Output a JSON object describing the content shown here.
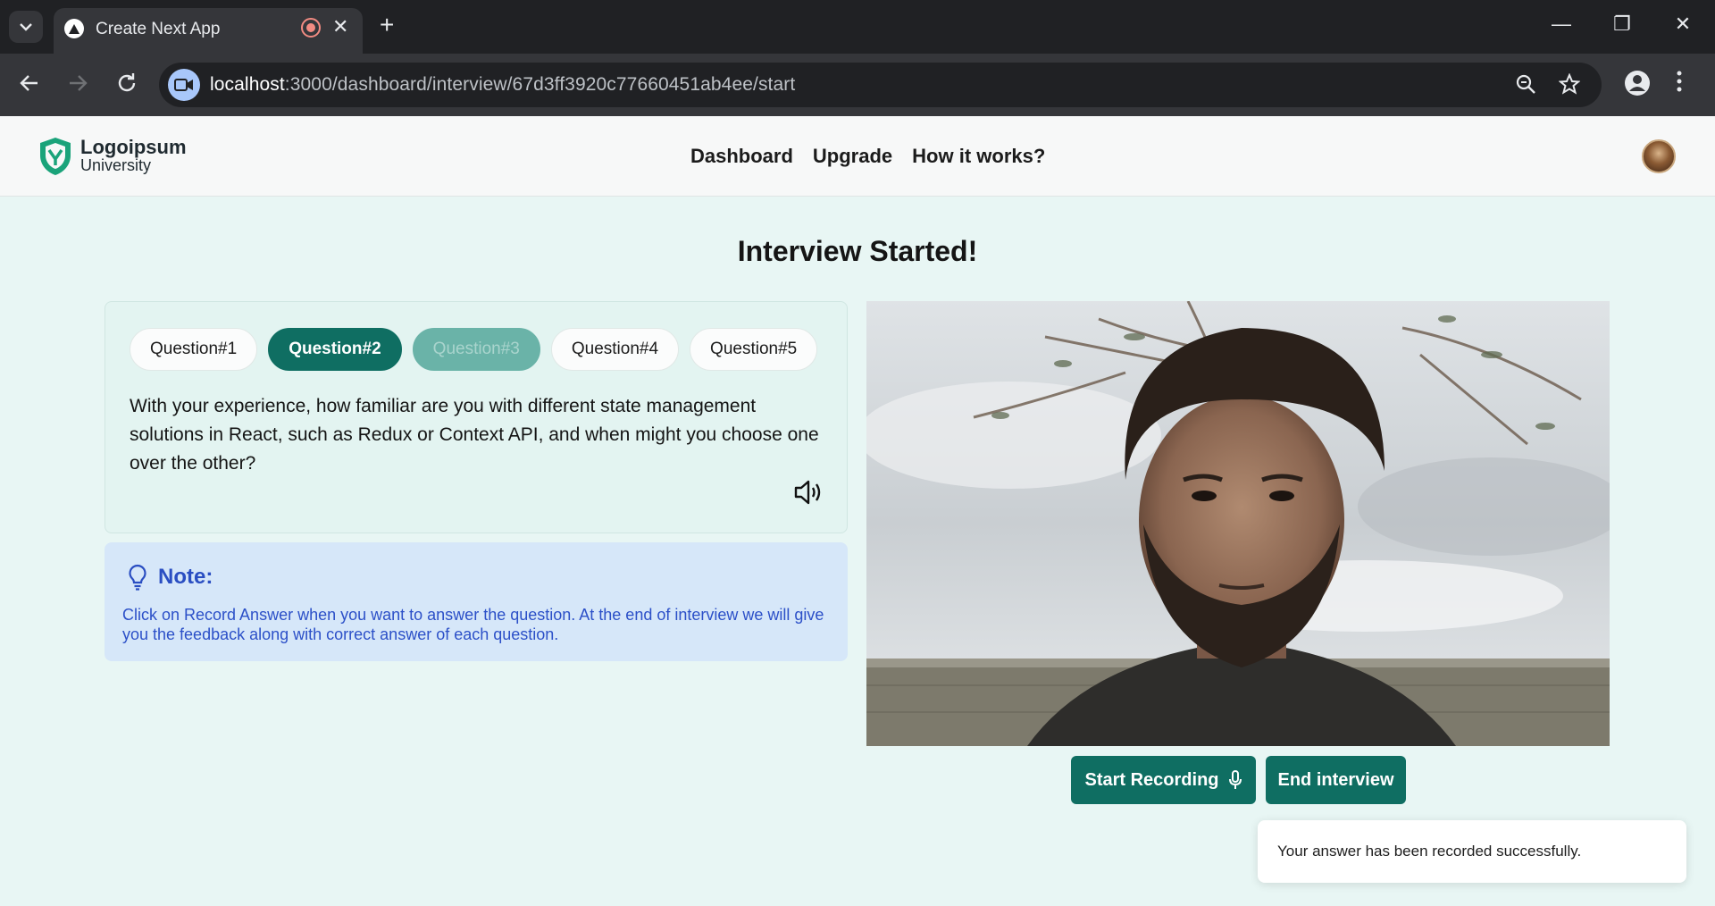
{
  "browser": {
    "tab_title": "Create Next App",
    "url_host": "localhost",
    "url_path": ":3000/dashboard/interview/67d3ff3920c77660451ab4ee/start",
    "new_tab_glyph": "+",
    "close_tab_glyph": "✕",
    "minimize_glyph": "—",
    "restore_glyph": "❐",
    "close_window_glyph": "✕"
  },
  "header": {
    "logo_name": "Logoipsum",
    "logo_sub": "University",
    "nav": [
      "Dashboard",
      "Upgrade",
      "How it works?"
    ]
  },
  "main": {
    "title": "Interview Started!",
    "questions": [
      "Question#1",
      "Question#2",
      "Question#3",
      "Question#4",
      "Question#5"
    ],
    "active_question_index": 1,
    "question_text": "With your experience, how familiar are you with different state management solutions in React, such as Redux or Context API, and when might you choose one over the other?",
    "note_title": "Note:",
    "note_text": "Click on Record Answer when you want to answer the question. At the end of interview we will give you the feedback along with correct answer of each question.",
    "start_recording_label": "Start Recording",
    "end_interview_label": "End interview"
  },
  "toast": {
    "message": "Your answer has been recorded successfully."
  },
  "colors": {
    "accent": "#0f6e62",
    "page_bg": "#e8f6f4",
    "note_bg": "#d6e7f9",
    "note_text": "#2a4ec2"
  },
  "icons": [
    "chevron-down-icon",
    "favicon-triangle-icon",
    "recording-icon",
    "close-icon",
    "plus-icon",
    "back-arrow-icon",
    "forward-arrow-icon",
    "reload-icon",
    "camera-chip-icon",
    "zoom-icon",
    "star-icon",
    "profile-icon",
    "kebab-menu-icon",
    "shield-logo-icon",
    "speaker-icon",
    "lightbulb-icon",
    "microphone-icon"
  ]
}
